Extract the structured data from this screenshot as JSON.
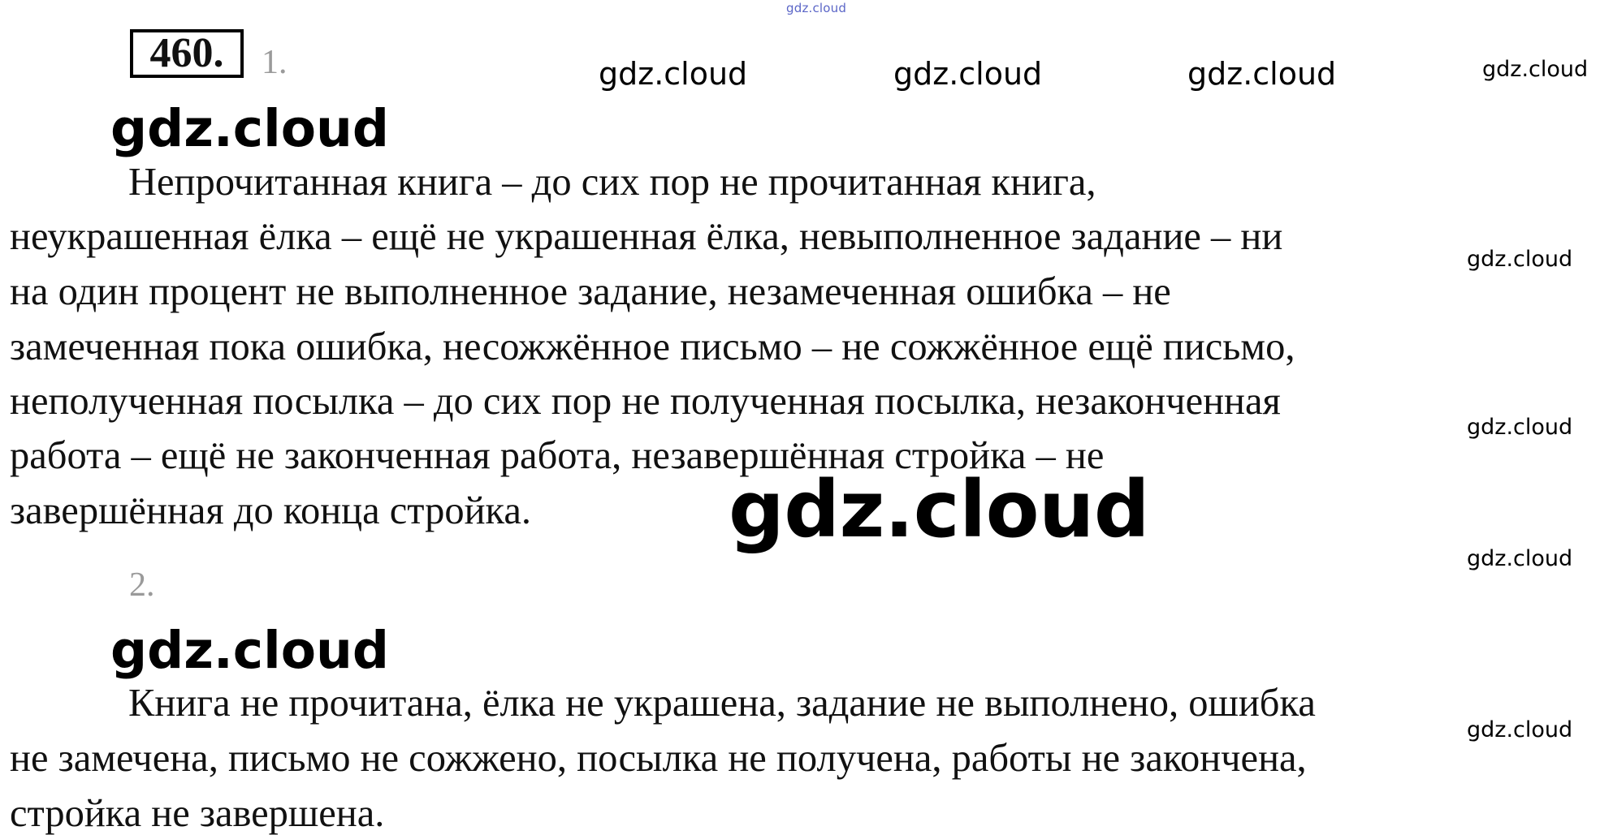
{
  "task": {
    "number": "460."
  },
  "watermarks": {
    "top_tiny": "gdz.cloud",
    "header": [
      "gdz.cloud",
      "gdz.cloud",
      "gdz.cloud",
      "gdz.cloud"
    ],
    "section_1": "gdz.cloud",
    "section_2": "gdz.cloud",
    "big_center": "gdz.cloud",
    "right_side": [
      "gdz.cloud",
      "gdz.cloud",
      "gdz.cloud",
      "gdz.cloud"
    ]
  },
  "part_1": {
    "number": "1.",
    "lines": [
      "Непрочитанная книга – до сих пор не прочитанная книга,",
      "неукрашенная ёлка – ещё не украшенная ёлка, невыполненное задание – ни",
      "на один процент не выполненное задание, незамеченная ошибка – не",
      "замеченная пока ошибка, несожжённое письмо – не сожжённое ещё письмо,",
      "неполученная посылка – до сих пор не полученная посылка, незаконченная",
      "работа – ещё не законченная работа, незавершённая стройка – не",
      "завершённая до конца стройка."
    ]
  },
  "part_2": {
    "number": "2.",
    "lines": [
      "Книга не прочитана, ёлка не украшена, задание не выполнено, ошибка",
      "не замечена, письмо не сожжено, посылка не получена, работы не закончена,",
      "стройка не завершена."
    ]
  }
}
